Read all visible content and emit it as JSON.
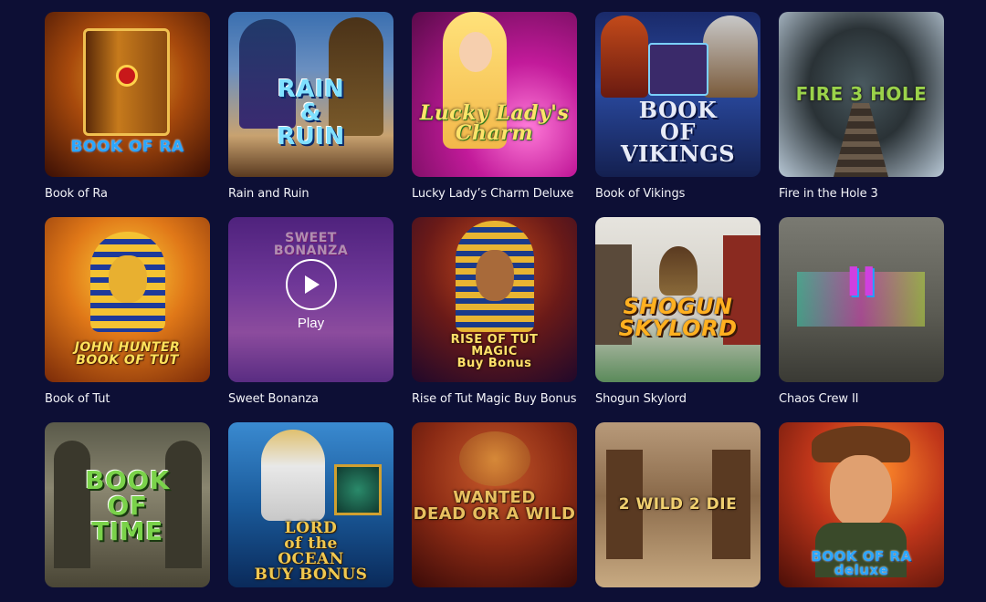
{
  "games": [
    {
      "id": "book-of-ra",
      "title": "Book of Ra",
      "logo": "BOOK OF RA"
    },
    {
      "id": "rain-and-ruin",
      "title": "Rain and Ruin",
      "logo": "RAIN\n&\nRUIN"
    },
    {
      "id": "lucky-ladys-charm-deluxe",
      "title": "Lucky Lady’s Charm Deluxe",
      "logo": "Lucky Lady's\nCharm"
    },
    {
      "id": "book-of-vikings",
      "title": "Book of Vikings",
      "logo": "BOOK\nOF\nVIKINGS"
    },
    {
      "id": "fire-in-the-hole-3",
      "title": "Fire in the Hole 3",
      "logo": "FIRE 3 HOLE"
    },
    {
      "id": "book-of-tut",
      "title": "Book of Tut",
      "logo": "JOHN HUNTER\nBOOK OF TUT"
    },
    {
      "id": "sweet-bonanza",
      "title": "Sweet Bonanza",
      "logo": "SWEET\nBONANZA",
      "play_label": "Play"
    },
    {
      "id": "rise-of-tut-magic-buy-bonus",
      "title": "Rise of Tut Magic Buy Bonus",
      "logo": "RISE OF TUT\nMAGIC\nBuy Bonus"
    },
    {
      "id": "shogun-skylord",
      "title": "Shogun Skylord",
      "logo": "SHOGUN\nSKYLORD"
    },
    {
      "id": "chaos-crew-ii",
      "title": "Chaos Crew II",
      "logo": "II"
    },
    {
      "id": "book-of-time",
      "title": "",
      "logo": "BOOK\nOF\nTIME"
    },
    {
      "id": "lord-of-the-ocean",
      "title": "",
      "logo": "LORD\nof the\nOCEAN\nBUY BONUS"
    },
    {
      "id": "wanted-dead-or-a-wild",
      "title": "",
      "logo": "WANTED\nDEAD OR A WILD"
    },
    {
      "id": "2-wild-2-die",
      "title": "",
      "logo": "2 WILD 2 DIE"
    },
    {
      "id": "book-of-ra-deluxe",
      "title": "",
      "logo": "BOOK OF RA\ndeluxe"
    }
  ],
  "colors": {
    "background": "#0d0f35",
    "title_text": "#f2f3f8"
  },
  "icons": {
    "play": "play-icon"
  }
}
